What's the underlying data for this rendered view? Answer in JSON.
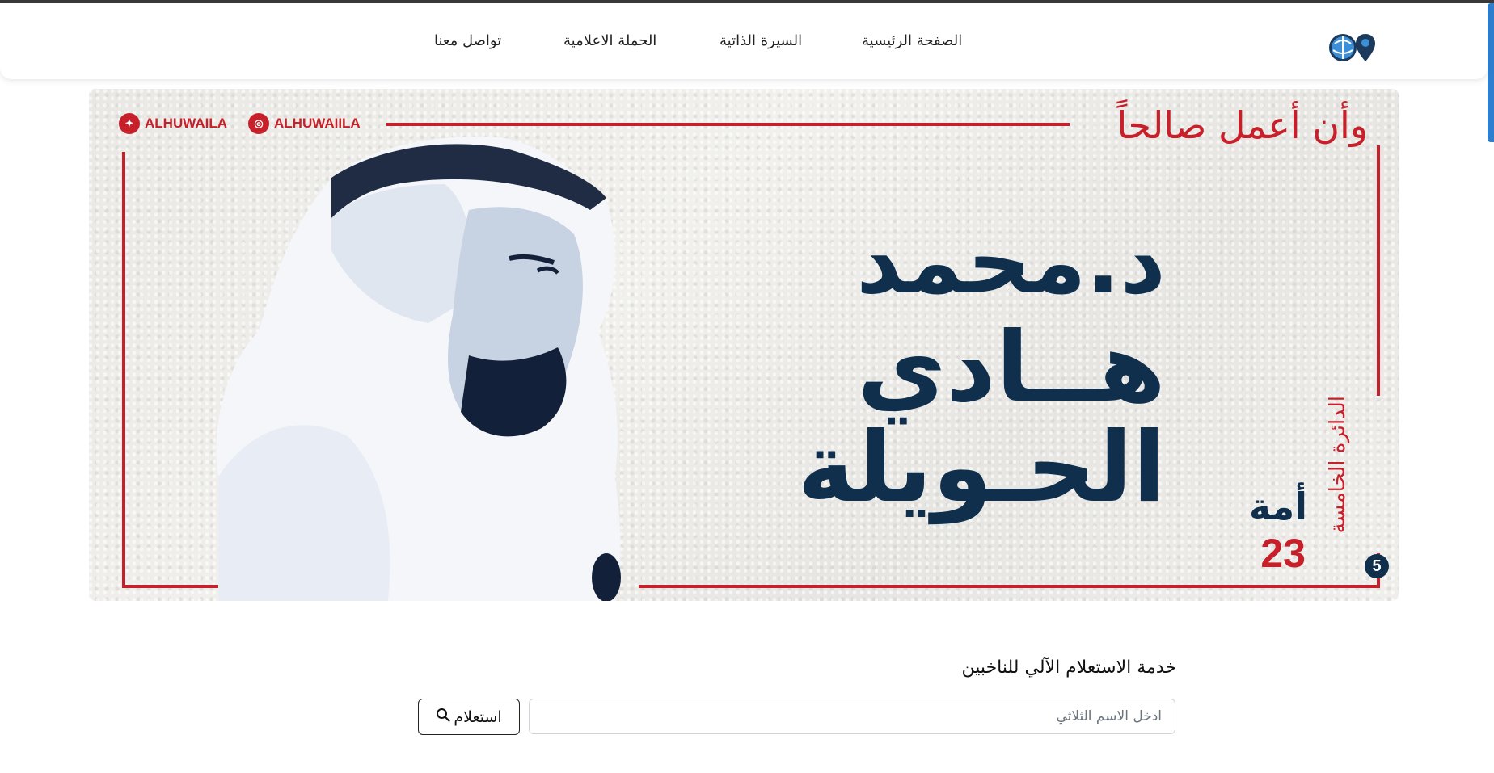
{
  "nav": {
    "links": [
      {
        "label": "الصفحة الرئيسية",
        "icon": ""
      },
      {
        "label": "السيرة الذاتية"
      },
      {
        "label": "الحملة الاعلامية"
      },
      {
        "label": "تواصل معنا"
      }
    ],
    "logo_icon": "globe-pin-logo-icon"
  },
  "hero": {
    "slogan": "وأن أعمل صالحاً",
    "name_line_1": "د.محمد",
    "name_line_2": "هــادي",
    "name_line_3": "الحـويلة",
    "umma": "أمة",
    "umma_number": "23",
    "district": "الدائرة الخامسة",
    "district_number": "5",
    "twitter_handle": "ALHUWAILA",
    "instagram_handle": "ALHUWAIILA",
    "accent_color": "#c8202a",
    "name_color": "#0f2f4d"
  },
  "inquiry": {
    "title": "خدمة الاستعلام الآلي للناخبين",
    "input_placeholder": "ادخل الاسم الثلاثي",
    "input_value": "",
    "button_label": "استعلام",
    "button_icon": "search-icon"
  }
}
